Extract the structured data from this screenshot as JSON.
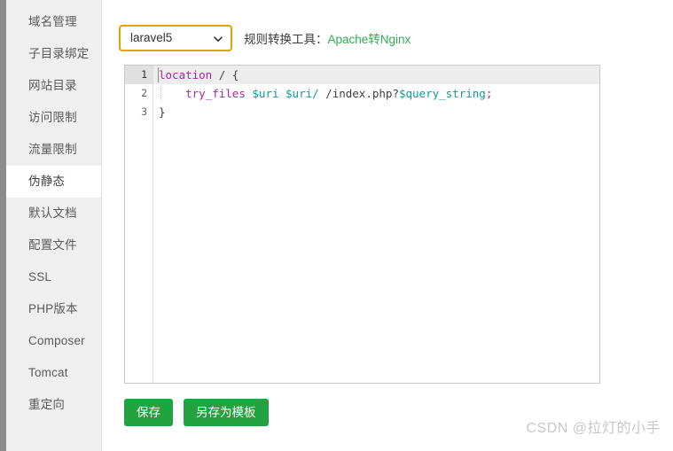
{
  "sidebar": {
    "items": [
      {
        "label": "域名管理",
        "active": false
      },
      {
        "label": "子目录绑定",
        "active": false
      },
      {
        "label": "网站目录",
        "active": false
      },
      {
        "label": "访问限制",
        "active": false
      },
      {
        "label": "流量限制",
        "active": false
      },
      {
        "label": "伪静态",
        "active": true
      },
      {
        "label": "默认文档",
        "active": false
      },
      {
        "label": "配置文件",
        "active": false
      },
      {
        "label": "SSL",
        "active": false
      },
      {
        "label": "PHP版本",
        "active": false
      },
      {
        "label": "Composer",
        "active": false
      },
      {
        "label": "Tomcat",
        "active": false
      },
      {
        "label": "重定向",
        "active": false
      }
    ]
  },
  "toolbar": {
    "select": {
      "value": "laravel5",
      "icon": "chevron-down-icon"
    },
    "converter_label": "规则转换工具：",
    "converter_link": "Apache转Nginx"
  },
  "editor": {
    "gutter": [
      "1",
      "2",
      "3"
    ],
    "lines": [
      {
        "active": true,
        "indented": false,
        "tokens": [
          {
            "text": "location",
            "type": "kw"
          },
          {
            "text": " / {",
            "type": "plain"
          }
        ]
      },
      {
        "active": false,
        "indented": true,
        "tokens": [
          {
            "text": "    ",
            "type": "plain"
          },
          {
            "text": "try_files",
            "type": "kw"
          },
          {
            "text": " ",
            "type": "plain"
          },
          {
            "text": "$uri",
            "type": "var"
          },
          {
            "text": " ",
            "type": "plain"
          },
          {
            "text": "$uri/",
            "type": "var"
          },
          {
            "text": " /index.php?",
            "type": "plain"
          },
          {
            "text": "$query_string",
            "type": "var"
          },
          {
            "text": ";",
            "type": "punct"
          }
        ]
      },
      {
        "active": false,
        "indented": false,
        "tokens": [
          {
            "text": "}",
            "type": "plain"
          }
        ]
      }
    ]
  },
  "buttons": {
    "save": "保存",
    "save_as_template": "另存为模板"
  },
  "watermark": "CSDN @拉灯的小手",
  "colors": {
    "accent_green": "#22a33f",
    "select_focus": "#e3a008",
    "link_green": "#2eae4e",
    "sidebar_bg": "#efefef"
  }
}
